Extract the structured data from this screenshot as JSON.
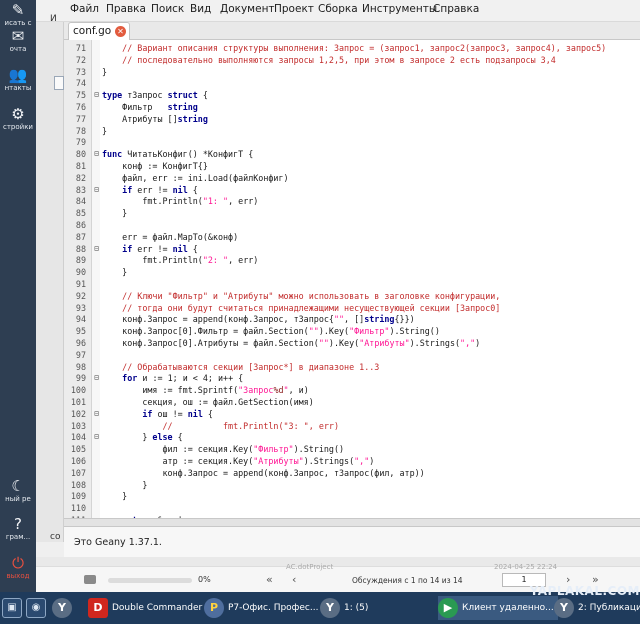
{
  "left_sidebar": {
    "items": [
      {
        "icon": "pencil-icon",
        "label": "исать с"
      },
      {
        "icon": "envelope-icon",
        "label": "очта"
      },
      {
        "icon": "users-icon",
        "label": "нтакты"
      },
      {
        "icon": "gear-icon",
        "label": "стройки"
      },
      {
        "icon": "moon-icon",
        "label": "ный ре"
      },
      {
        "icon": "question-icon",
        "label": "грам..."
      },
      {
        "icon": "power-icon",
        "label": "выход"
      }
    ]
  },
  "geany": {
    "menu": [
      "Файл",
      "Правка",
      "Поиск",
      "Вид",
      "Документ",
      "Проект",
      "Сборка",
      "Инструменты",
      "Справка"
    ],
    "side_strip_text": [
      "И",
      "со"
    ],
    "tab": {
      "label": "conf.go",
      "close_icon": "close-icon"
    },
    "code_lines": [
      {
        "n": "71",
        "fold": "",
        "tokens": [
          [
            "t-com",
            "    // Вариант описания структуры выполнения: Запрос = (запрос1, запрос2(запрос3, запрос4), запрос5)"
          ]
        ]
      },
      {
        "n": "72",
        "fold": "",
        "tokens": [
          [
            "t-com",
            "    // последовательно выполняются запросы 1,2,5, при этом в запросе 2 есть подзапросы 3,4"
          ]
        ]
      },
      {
        "n": "73",
        "fold": "",
        "tokens": [
          [
            "t-def",
            "}"
          ]
        ]
      },
      {
        "n": "74",
        "fold": "",
        "tokens": []
      },
      {
        "n": "75",
        "fold": "⊟",
        "tokens": [
          [
            "t-kw",
            "type"
          ],
          [
            "t-def",
            " тЗапрос "
          ],
          [
            "t-kw",
            "struct"
          ],
          [
            "t-def",
            " {"
          ]
        ]
      },
      {
        "n": "76",
        "fold": "",
        "tokens": [
          [
            "t-def",
            "    Фильтр   "
          ],
          [
            "t-kw",
            "string"
          ]
        ]
      },
      {
        "n": "77",
        "fold": "",
        "tokens": [
          [
            "t-def",
            "    Атрибуты []"
          ],
          [
            "t-kw",
            "string"
          ]
        ]
      },
      {
        "n": "78",
        "fold": "",
        "tokens": [
          [
            "t-def",
            "}"
          ]
        ]
      },
      {
        "n": "79",
        "fold": "",
        "tokens": []
      },
      {
        "n": "80",
        "fold": "⊟",
        "tokens": [
          [
            "t-kw",
            "func"
          ],
          [
            "t-def",
            " ЧитатьКонфиг() *КонфигТ {"
          ]
        ]
      },
      {
        "n": "81",
        "fold": "",
        "tokens": [
          [
            "t-def",
            "    конф := КонфигТ{}"
          ]
        ]
      },
      {
        "n": "82",
        "fold": "",
        "tokens": [
          [
            "t-def",
            "    файл, err := ini.Load(файлКонфиг)"
          ]
        ]
      },
      {
        "n": "83",
        "fold": "⊟",
        "tokens": [
          [
            "t-def",
            "    "
          ],
          [
            "t-kw",
            "if"
          ],
          [
            "t-def",
            " err != "
          ],
          [
            "t-kw",
            "nil"
          ],
          [
            "t-def",
            " {"
          ]
        ]
      },
      {
        "n": "84",
        "fold": "",
        "tokens": [
          [
            "t-def",
            "        fmt.Println("
          ],
          [
            "t-str",
            "\"1: \""
          ],
          [
            "t-def",
            ", err)"
          ]
        ]
      },
      {
        "n": "85",
        "fold": "",
        "tokens": [
          [
            "t-def",
            "    }"
          ]
        ]
      },
      {
        "n": "86",
        "fold": "",
        "tokens": []
      },
      {
        "n": "87",
        "fold": "",
        "tokens": [
          [
            "t-def",
            "    err = файл.MapTo(&конф)"
          ]
        ]
      },
      {
        "n": "88",
        "fold": "⊟",
        "tokens": [
          [
            "t-def",
            "    "
          ],
          [
            "t-kw",
            "if"
          ],
          [
            "t-def",
            " err != "
          ],
          [
            "t-kw",
            "nil"
          ],
          [
            "t-def",
            " {"
          ]
        ]
      },
      {
        "n": "89",
        "fold": "",
        "tokens": [
          [
            "t-def",
            "        fmt.Println("
          ],
          [
            "t-str",
            "\"2: \""
          ],
          [
            "t-def",
            ", err)"
          ]
        ]
      },
      {
        "n": "90",
        "fold": "",
        "tokens": [
          [
            "t-def",
            "    }"
          ]
        ]
      },
      {
        "n": "91",
        "fold": "",
        "tokens": []
      },
      {
        "n": "92",
        "fold": "",
        "tokens": [
          [
            "t-com",
            "    // Ключи \"Фильтр\" и \"Атрибуты\" можно использовать в заголовке конфигурации,"
          ]
        ]
      },
      {
        "n": "93",
        "fold": "",
        "tokens": [
          [
            "t-com",
            "    // тогда они будут считаться принадлежащими несуществующей секции [Запрос0]"
          ]
        ]
      },
      {
        "n": "94",
        "fold": "",
        "tokens": [
          [
            "t-def",
            "    конф.Запрос = append(конф.Запрос, тЗапрос{"
          ],
          [
            "t-str",
            "\"\""
          ],
          [
            "t-def",
            ", []"
          ],
          [
            "t-kw",
            "string"
          ],
          [
            "t-def",
            "{}})"
          ]
        ]
      },
      {
        "n": "95",
        "fold": "",
        "tokens": [
          [
            "t-def",
            "    конф.Запрос[0].Фильтр = файл.Section("
          ],
          [
            "t-str",
            "\"\""
          ],
          [
            "t-def",
            ").Key("
          ],
          [
            "t-str",
            "\"Фильтр\""
          ],
          [
            "t-def",
            ").String()"
          ]
        ]
      },
      {
        "n": "96",
        "fold": "",
        "tokens": [
          [
            "t-def",
            "    конф.Запрос[0].Атрибуты = файл.Section("
          ],
          [
            "t-str",
            "\"\""
          ],
          [
            "t-def",
            ").Key("
          ],
          [
            "t-str",
            "\"Атрибуты\""
          ],
          [
            "t-def",
            ").Strings("
          ],
          [
            "t-str",
            "\",\""
          ],
          [
            "t-def",
            ")"
          ]
        ]
      },
      {
        "n": "97",
        "fold": "",
        "tokens": []
      },
      {
        "n": "98",
        "fold": "",
        "tokens": [
          [
            "t-com",
            "    // Обрабатываются секции [Запрос*] в диапазоне 1..3"
          ]
        ]
      },
      {
        "n": "99",
        "fold": "⊟",
        "tokens": [
          [
            "t-def",
            "    "
          ],
          [
            "t-kw",
            "for"
          ],
          [
            "t-def",
            " и := 1; и < 4; и++ {"
          ]
        ]
      },
      {
        "n": "100",
        "fold": "",
        "tokens": [
          [
            "t-def",
            "        имя := fmt.Sprintf("
          ],
          [
            "t-str",
            "\"Запрос"
          ],
          [
            "t-pct",
            "%d"
          ],
          [
            "t-str",
            "\""
          ],
          [
            "t-def",
            ", и)"
          ]
        ]
      },
      {
        "n": "101",
        "fold": "",
        "tokens": [
          [
            "t-def",
            "        секция, ош := файл.GetSection(имя)"
          ]
        ]
      },
      {
        "n": "102",
        "fold": "⊟",
        "tokens": [
          [
            "t-def",
            "        "
          ],
          [
            "t-kw",
            "if"
          ],
          [
            "t-def",
            " ош != "
          ],
          [
            "t-kw",
            "nil"
          ],
          [
            "t-def",
            " {"
          ]
        ]
      },
      {
        "n": "103",
        "fold": "",
        "tokens": [
          [
            "t-com",
            "            //          fmt.Println(\"3: \", err)"
          ]
        ]
      },
      {
        "n": "104",
        "fold": "⊟",
        "tokens": [
          [
            "t-def",
            "        } "
          ],
          [
            "t-kw",
            "else"
          ],
          [
            "t-def",
            " {"
          ]
        ]
      },
      {
        "n": "105",
        "fold": "",
        "tokens": [
          [
            "t-def",
            "            фил := секция.Key("
          ],
          [
            "t-str",
            "\"Фильтр\""
          ],
          [
            "t-def",
            ").String()"
          ]
        ]
      },
      {
        "n": "106",
        "fold": "",
        "tokens": [
          [
            "t-def",
            "            атр := секция.Key("
          ],
          [
            "t-str",
            "\"Атрибуты\""
          ],
          [
            "t-def",
            ").Strings("
          ],
          [
            "t-str",
            "\",\""
          ],
          [
            "t-def",
            ")"
          ]
        ]
      },
      {
        "n": "107",
        "fold": "",
        "tokens": [
          [
            "t-def",
            "            конф.Запрос = append(конф.Запрос, тЗапрос(фил, атр))"
          ]
        ]
      },
      {
        "n": "108",
        "fold": "",
        "tokens": [
          [
            "t-def",
            "        }"
          ]
        ]
      },
      {
        "n": "109",
        "fold": "",
        "tokens": [
          [
            "t-def",
            "    }"
          ]
        ]
      },
      {
        "n": "110",
        "fold": "",
        "tokens": []
      },
      {
        "n": "111",
        "fold": "",
        "tokens": [
          [
            "t-def",
            "    "
          ],
          [
            "t-kw",
            "return"
          ],
          [
            "t-def",
            " &конф"
          ]
        ]
      }
    ],
    "message": "Это Geany 1.37.1."
  },
  "background_app": {
    "progress_value": 0,
    "progress_label": "0%",
    "nav_first": "«",
    "nav_prev": "‹",
    "discussions_label": "Обсуждения с 1 по 14 из 14",
    "page_number": "1",
    "nav_next": "›",
    "nav_last": "»",
    "faded_top_left": "AC.dotProject",
    "faded_top_right": "2024-04-25 22:24"
  },
  "taskbar": {
    "items": [
      {
        "kind": "square",
        "icon": "window-icon",
        "label": ""
      },
      {
        "kind": "square",
        "icon": "yandex-icon",
        "label": ""
      },
      {
        "kind": "button",
        "icon": "ya-icon",
        "label": ""
      },
      {
        "kind": "button",
        "icon": "double-commander-icon",
        "label": "Double Commander"
      },
      {
        "kind": "button",
        "icon": "r7-office-icon",
        "label": "Р7-Офис. Профес..."
      },
      {
        "kind": "button",
        "icon": "ya-icon",
        "label": "1: (5)"
      },
      {
        "kind": "button",
        "icon": "client-icon",
        "label": "Клиент удаленно..."
      },
      {
        "kind": "button",
        "icon": "ya-icon",
        "label": "2: Публикации"
      }
    ]
  },
  "watermark": "YAPLAKAL.COM",
  "colors": {
    "sidebar_bg": "#2e3e52",
    "taskbar_bg": "#1f3b5c",
    "comment": "#c22c2c",
    "keyword": "#00008b",
    "string": "#ff1493",
    "tab_close": "#e25b3e"
  }
}
